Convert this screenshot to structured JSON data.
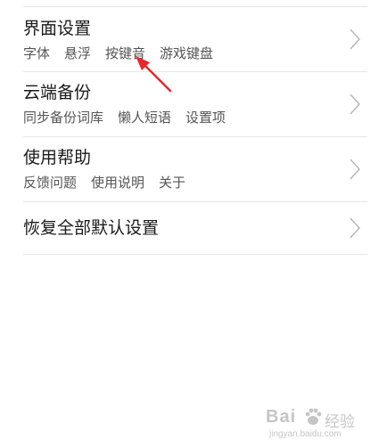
{
  "settings": {
    "rows": [
      {
        "title": "界面设置",
        "subitems": [
          "字体",
          "悬浮",
          "按键音",
          "游戏键盘"
        ]
      },
      {
        "title": "云端备份",
        "subitems": [
          "同步备份词库",
          "懒人短语",
          "设置项"
        ]
      },
      {
        "title": "使用帮助",
        "subitems": [
          "反馈问题",
          "使用说明",
          "关于"
        ]
      },
      {
        "title": "恢复全部默认设置",
        "subitems": []
      }
    ]
  },
  "annotation": {
    "arrow_color": "#e8262b"
  },
  "watermark": {
    "brand": "Bai",
    "brand_suffix": "经验",
    "url": "jingyan.baidu.com"
  },
  "colors": {
    "background": "#ffffff",
    "divider": "#e6e6e6",
    "title_text": "#1a1a1a",
    "sub_text": "#555555",
    "chevron": "#b5b5b5"
  }
}
